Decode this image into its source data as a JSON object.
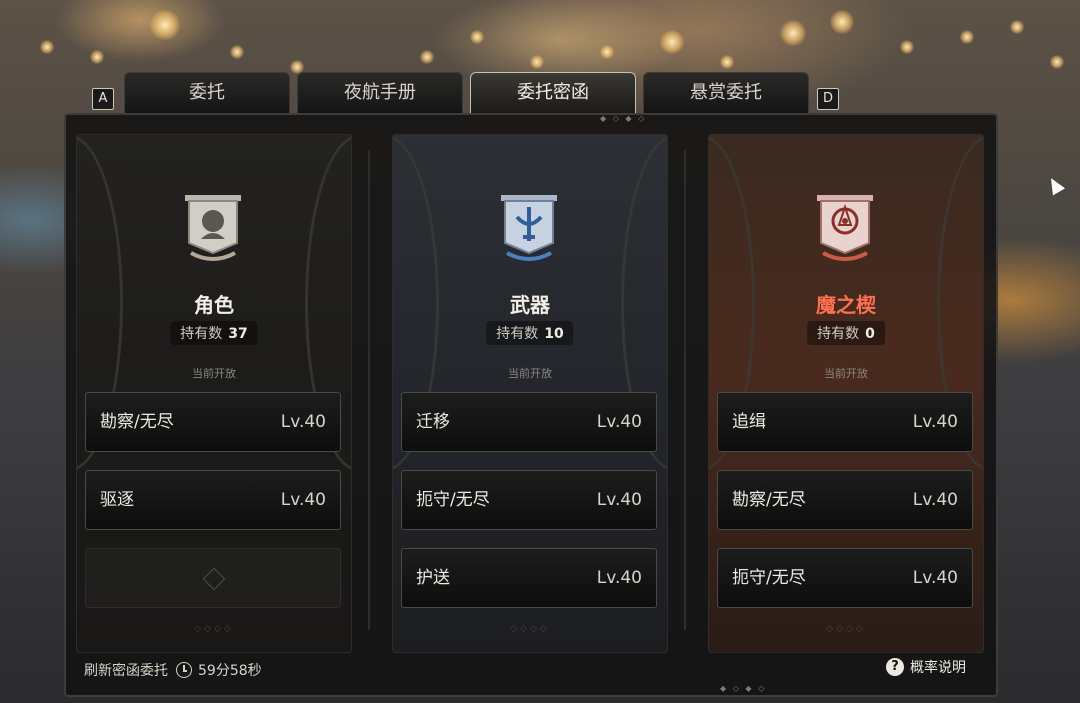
{
  "tabs": [
    {
      "key": "A",
      "label": "委托",
      "active": false
    },
    {
      "key": "",
      "label": "夜航手册",
      "active": false
    },
    {
      "key": "",
      "label": "委托密函",
      "active": true
    },
    {
      "key": "D",
      "label": "悬赏委托",
      "active": false
    }
  ],
  "tab_keys": {
    "left": "A",
    "right": "D"
  },
  "columns": [
    {
      "category": "角色",
      "category_color": "#f3efe6",
      "count_label": "持有数",
      "count": "37",
      "status": "当前开放",
      "emblem": "character-emblem-icon",
      "missions": [
        {
          "name": "勘察/无尽",
          "level": "Lv.40"
        },
        {
          "name": "驱逐",
          "level": "Lv.40"
        },
        {
          "name": "",
          "level": "",
          "empty": true
        }
      ]
    },
    {
      "category": "武器",
      "category_color": "#f3efe6",
      "count_label": "持有数",
      "count": "10",
      "status": "当前开放",
      "emblem": "weapon-emblem-icon",
      "missions": [
        {
          "name": "迁移",
          "level": "Lv.40"
        },
        {
          "name": "扼守/无尽",
          "level": "Lv.40"
        },
        {
          "name": "护送",
          "level": "Lv.40"
        }
      ]
    },
    {
      "category": "魔之楔",
      "category_color": "#ff7050",
      "count_label": "持有数",
      "count": "0",
      "status": "当前开放",
      "emblem": "demon-wedge-emblem-icon",
      "missions": [
        {
          "name": "追缉",
          "level": "Lv.40"
        },
        {
          "name": "勘察/无尽",
          "level": "Lv.40"
        },
        {
          "name": "扼守/无尽",
          "level": "Lv.40"
        }
      ]
    }
  ],
  "footer": {
    "refresh_label": "刷新密函委托",
    "refresh_time": "59分58秒",
    "probability_label": "概率说明",
    "probability_icon": "?"
  }
}
